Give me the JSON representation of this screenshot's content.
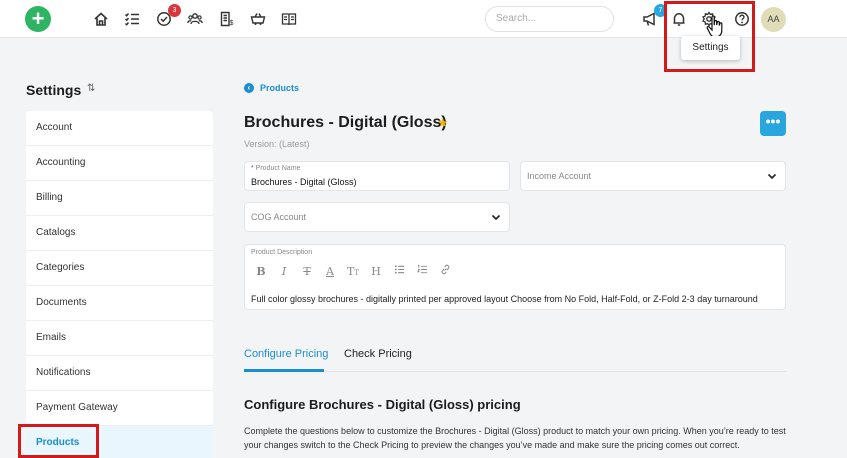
{
  "header": {
    "search_placeholder": "Search...",
    "avatar_initials": "AA",
    "tasks_badge": "3",
    "announcements_badge": "7",
    "tooltip": "Settings"
  },
  "sidebar": {
    "title": "Settings",
    "items": [
      {
        "label": "Account"
      },
      {
        "label": "Accounting"
      },
      {
        "label": "Billing"
      },
      {
        "label": "Catalogs"
      },
      {
        "label": "Categories"
      },
      {
        "label": "Documents"
      },
      {
        "label": "Emails"
      },
      {
        "label": "Notifications"
      },
      {
        "label": "Payment Gateway"
      },
      {
        "label": "Products"
      }
    ]
  },
  "main": {
    "breadcrumb": "Products",
    "title": "Brochures - Digital (Gloss)",
    "version": "Version: (Latest)",
    "product_name_label": "Product Name",
    "product_name_value": "Brochures - Digital (Gloss)",
    "income_account_placeholder": "Income Account",
    "cog_account_placeholder": "COG Account",
    "description_label": "Product Description",
    "description_text": "Full color glossy brochures - digitally printed per approved layout Choose from No Fold, Half-Fold, or Z-Fold 2-3 day turnaround",
    "tabs": [
      {
        "label": "Configure Pricing"
      },
      {
        "label": "Check Pricing"
      }
    ],
    "section_title": "Configure Brochures - Digital (Gloss) pricing",
    "section_desc": "Complete the questions below to customize the Brochures - Digital (Gloss) product to match your own pricing. When you’re ready to test your changes switch to the Check Pricing to preview the changes you’ve made and make sure the pricing comes out correct."
  },
  "colors": {
    "accent": "#1a8fd0",
    "add_button": "#2fb463",
    "highlight_box": "#d21a1a",
    "star": "#f0b400"
  }
}
